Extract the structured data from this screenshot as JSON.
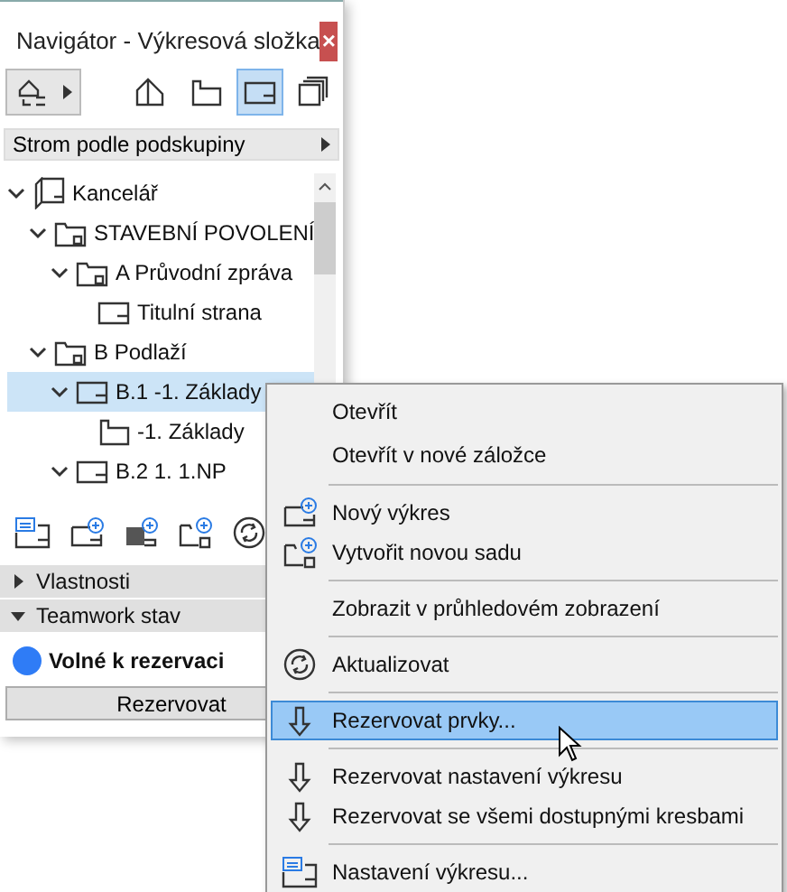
{
  "window": {
    "title": "Navigátor - Výkresová složka",
    "close": "×"
  },
  "view_buttons": [
    {
      "kind": "project",
      "selected": false
    },
    {
      "kind": "view",
      "selected": false
    },
    {
      "kind": "layout",
      "selected": true
    },
    {
      "kind": "publisher",
      "selected": false
    }
  ],
  "tree_mode": {
    "label": "Strom podle podskupiny"
  },
  "tree": [
    {
      "label": "Kancelář",
      "kind": "book",
      "expanded": true,
      "selected": false,
      "children": [
        {
          "label": "STAVEBNÍ POVOLENÍ",
          "kind": "folder",
          "expanded": true,
          "selected": false,
          "children": [
            {
              "label": "A Průvodní zpráva",
              "kind": "folder",
              "expanded": true,
              "selected": false,
              "children": [
                {
                  "label": "Titulní strana",
                  "kind": "layout",
                  "selected": false
                }
              ]
            }
          ]
        },
        {
          "label": "B Podlaží",
          "kind": "folder",
          "expanded": true,
          "selected": false,
          "children": [
            {
              "label": "B.1 -1. Základy",
              "kind": "layout",
              "expanded": true,
              "selected": true,
              "children": [
                {
                  "label": "-1. Základy",
                  "kind": "view",
                  "selected": false
                }
              ]
            },
            {
              "label": "B.2 1. 1.NP",
              "kind": "layout",
              "expanded": true,
              "selected": false
            }
          ]
        }
      ]
    }
  ],
  "sections": [
    {
      "label": "Vlastnosti",
      "expanded": false
    },
    {
      "label": "Teamwork stav",
      "expanded": true
    }
  ],
  "status": {
    "label": "Volné k rezervaci",
    "color": "#2f7cf6"
  },
  "reserve_button": "Rezervovat",
  "context_menu": [
    {
      "kind": "plain",
      "label": "Otevřít",
      "selected": false
    },
    {
      "kind": "plain",
      "label": "Otevřít v nové záložce",
      "selected": false
    },
    {
      "kind": "separator"
    },
    {
      "kind": "new-drawing",
      "label": "Nový výkres",
      "selected": false
    },
    {
      "kind": "new-set",
      "label": "Vytvořit novou sadu",
      "selected": false
    },
    {
      "kind": "separator"
    },
    {
      "kind": "plain",
      "label": "Zobrazit v průhledovém zobrazení",
      "selected": false
    },
    {
      "kind": "separator"
    },
    {
      "kind": "refresh",
      "label": "Aktualizovat",
      "selected": false
    },
    {
      "kind": "separator"
    },
    {
      "kind": "reserve",
      "label": "Rezervovat prvky...",
      "selected": true
    },
    {
      "kind": "separator"
    },
    {
      "kind": "reserve",
      "label": "Rezervovat nastavení výkresu",
      "selected": false
    },
    {
      "kind": "reserve",
      "label": "Rezervovat se všemi dostupnými kresbami",
      "selected": false
    },
    {
      "kind": "separator"
    },
    {
      "kind": "settings",
      "label": "Nastavení výkresu...",
      "selected": false
    }
  ]
}
